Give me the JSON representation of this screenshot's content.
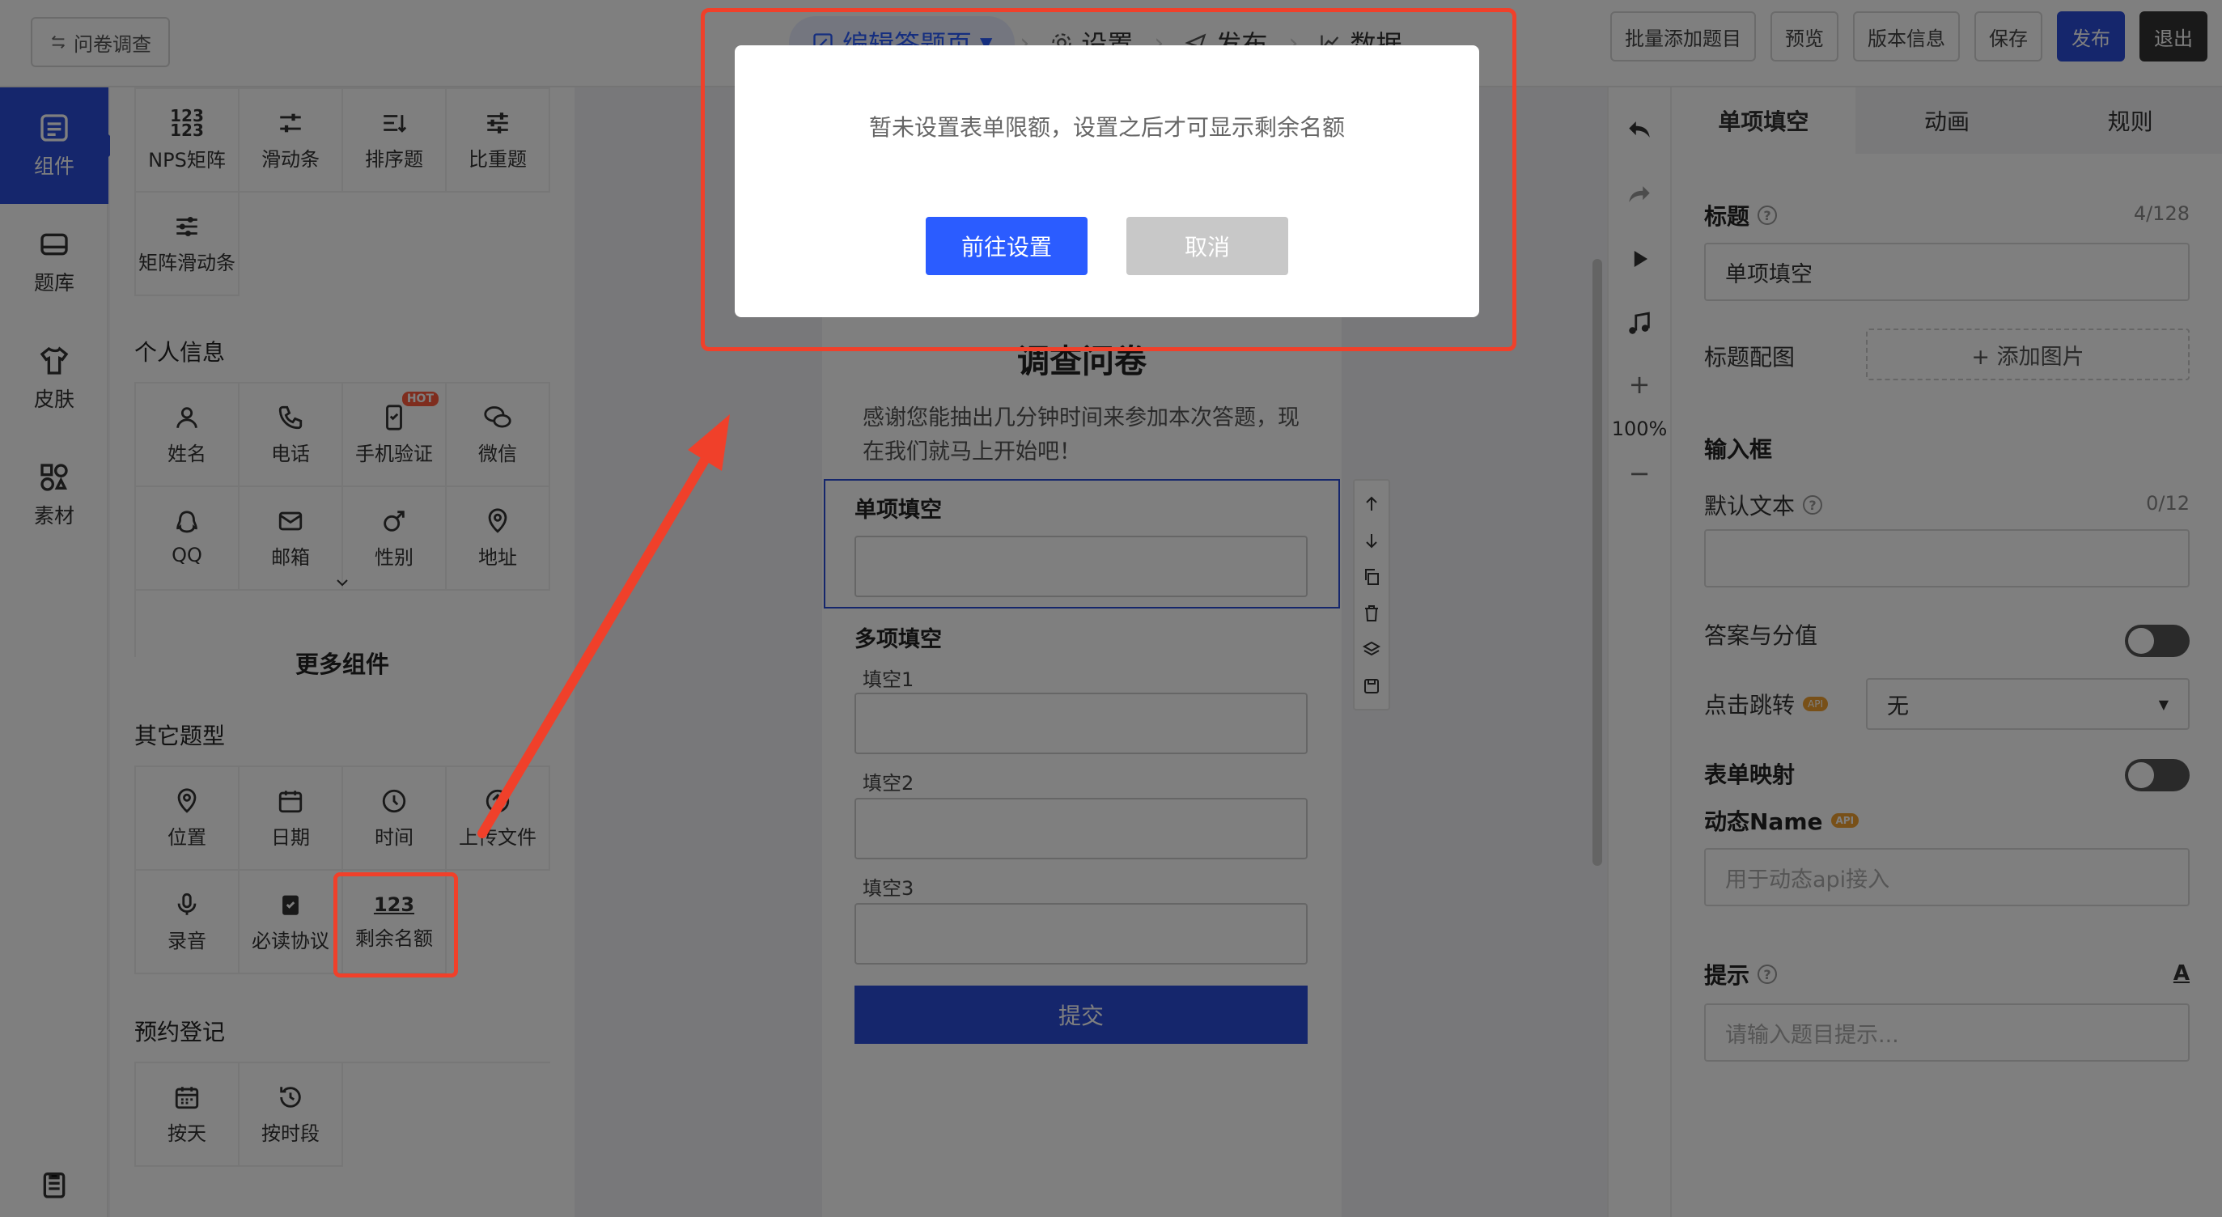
{
  "topbar": {
    "back_label": "问卷调查",
    "steps": [
      {
        "label": "编辑答题页"
      },
      {
        "label": "设置"
      },
      {
        "label": "发布"
      },
      {
        "label": "数据"
      }
    ],
    "buttons": {
      "batch_add": "批量添加题目",
      "preview": "预览",
      "version": "版本信息",
      "save": "保存",
      "publish": "发布",
      "exit": "退出"
    }
  },
  "leftnav": {
    "items": [
      {
        "label": "组件",
        "icon": "component-icon"
      },
      {
        "label": "题库",
        "icon": "question-bank-icon"
      },
      {
        "label": "皮肤",
        "icon": "skin-icon"
      },
      {
        "label": "素材",
        "icon": "material-icon"
      }
    ]
  },
  "components": {
    "top_group": [
      {
        "label": "NPS矩阵"
      },
      {
        "label": "滑动条"
      },
      {
        "label": "排序题"
      },
      {
        "label": "比重题"
      },
      {
        "label": "矩阵滑动条"
      }
    ],
    "personal_title": "个人信息",
    "personal": [
      {
        "label": "姓名"
      },
      {
        "label": "电话"
      },
      {
        "label": "手机验证",
        "badge": "HOT"
      },
      {
        "label": "微信"
      },
      {
        "label": "QQ"
      },
      {
        "label": "邮箱"
      },
      {
        "label": "性别"
      },
      {
        "label": "地址"
      }
    ],
    "more_title": "更多组件",
    "other_title": "其它题型",
    "other": [
      {
        "label": "位置"
      },
      {
        "label": "日期"
      },
      {
        "label": "时间"
      },
      {
        "label": "上传文件"
      },
      {
        "label": "录音"
      },
      {
        "label": "必读协议"
      },
      {
        "label": "剩余名额"
      }
    ],
    "booking_title": "预约登记",
    "booking": [
      {
        "label": "按天"
      },
      {
        "label": "按时段"
      }
    ]
  },
  "survey": {
    "title": "调查问卷",
    "intro": "感谢您能抽出几分钟时间来参加本次答题，现在我们就马上开始吧！",
    "q1_title": "单项填空",
    "q2_title": "多项填空",
    "q2_fields": [
      "填空1",
      "填空2",
      "填空3"
    ],
    "submit_label": "提交"
  },
  "zoom": "100%",
  "right_panel": {
    "tabs": [
      "单项填空",
      "动画",
      "规则"
    ],
    "title_label": "标题",
    "title_count": "4/128",
    "title_value": "单项填空",
    "title_image_label": "标题配图",
    "add_image": "+ 添加图片",
    "input_section": "输入框",
    "default_text_label": "默认文本",
    "default_text_count": "0/12",
    "answer_score_label": "答案与分值",
    "jump_label": "点击跳转",
    "jump_value": "无",
    "form_map_label": "表单映射",
    "dynamic_name_label": "动态Name",
    "dynamic_name_placeholder": "用于动态api接入",
    "hint_label": "提示",
    "hint_placeholder": "请输入题目提示...",
    "api_badge": "API"
  },
  "modal": {
    "message": "暂未设置表单限额，设置之后才可显示剩余名额",
    "ok_label": "前往设置",
    "cancel_label": "取消"
  },
  "colors": {
    "primary": "#2b4cd8",
    "annotation": "#f0402a"
  }
}
